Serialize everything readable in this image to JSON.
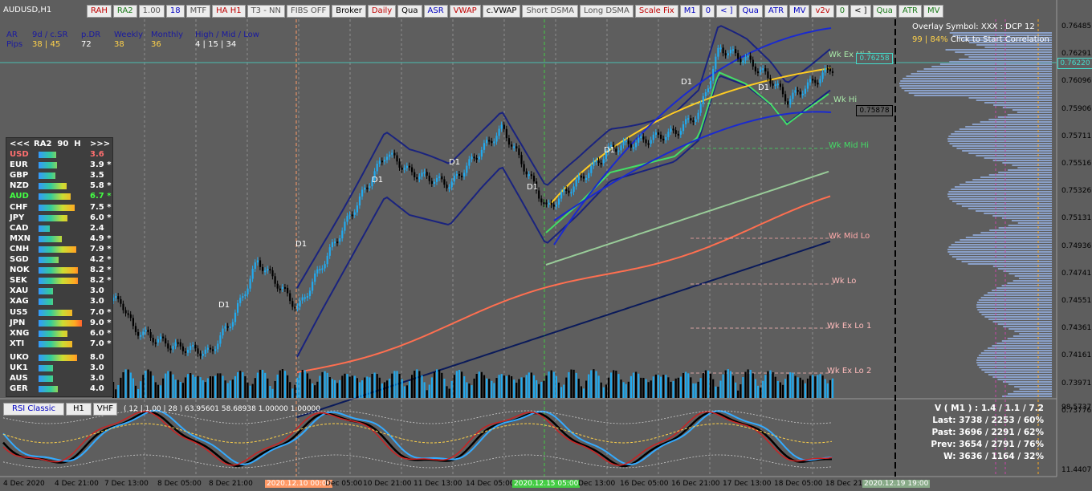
{
  "window": {
    "symbol": "AUDUSD,H1"
  },
  "toolbar": [
    {
      "label": "RAH",
      "color": "#c00000"
    },
    {
      "label": "RA2",
      "color": "#1a7a1a"
    },
    {
      "label": "1.00",
      "color": "#555555"
    },
    {
      "label": "18",
      "color": "#0000c0"
    },
    {
      "label": "MTF",
      "color": "#555555"
    },
    {
      "label": "HA H1",
      "color": "#c00000"
    },
    {
      "label": "T3 - NN",
      "color": "#555555"
    },
    {
      "label": "FIBS OFF",
      "color": "#555555"
    },
    {
      "label": "Broker",
      "color": "#000000"
    },
    {
      "label": "Daily",
      "color": "#c00000"
    },
    {
      "label": "Qua",
      "color": "#000000"
    },
    {
      "label": "ASR",
      "color": "#0000c0"
    },
    {
      "label": "VWAP",
      "color": "#c00000"
    },
    {
      "label": "c.VWAP",
      "color": "#000000"
    },
    {
      "label": "Short DSMA",
      "color": "#555555"
    },
    {
      "label": "Long DSMA",
      "color": "#555555"
    },
    {
      "label": "Scale Fix",
      "color": "#c00000"
    },
    {
      "label": "M1",
      "color": "#0000c0"
    },
    {
      "label": "0",
      "color": "#0000c0"
    },
    {
      "label": "< ]",
      "color": "#0000c0"
    },
    {
      "label": "Qua",
      "color": "#0000c0"
    },
    {
      "label": "ATR",
      "color": "#0000c0"
    },
    {
      "label": "MV",
      "color": "#0000c0"
    },
    {
      "label": "v2v",
      "color": "#c00000"
    },
    {
      "label": "0",
      "color": "#1a7a1a"
    },
    {
      "label": "< ]",
      "color": "#000000"
    },
    {
      "label": "Qua",
      "color": "#1a7a1a"
    },
    {
      "label": "ATR",
      "color": "#1a7a1a"
    },
    {
      "label": "MV",
      "color": "#1a7a1a"
    }
  ],
  "stats": {
    "headers": [
      "AR",
      "9d / c.SR",
      "p.DR",
      "Weekly",
      "Monthly",
      "High / Mid / Low"
    ],
    "row_label": "Pips",
    "values": [
      "38 | 45",
      "72",
      "38",
      "36",
      "4 | 15 | 34"
    ]
  },
  "overlay": {
    "line1": "Overlay Symbol: XXX : DCP 12",
    "line2_pct": "99 | 84%",
    "line2_text": "Click to Start Correlation"
  },
  "ra2_panel": {
    "header_left": "<<<",
    "title": "RA2  90  H",
    "header_right": ">>>",
    "rows": [
      {
        "cur": "USD",
        "val": "3.6",
        "color": "#ff6f6f",
        "bar": 0.36
      },
      {
        "cur": "EUR",
        "val": "3.9 *",
        "color": "#ffffff",
        "bar": 0.39
      },
      {
        "cur": "GBP",
        "val": "3.5",
        "color": "#ffffff",
        "bar": 0.35
      },
      {
        "cur": "NZD",
        "val": "5.8 *",
        "color": "#ffffff",
        "bar": 0.58
      },
      {
        "cur": "AUD",
        "val": "6.7 *",
        "color": "#44ff44",
        "bar": 0.67
      },
      {
        "cur": "CHF",
        "val": "7.5 *",
        "color": "#ffffff",
        "bar": 0.75
      },
      {
        "cur": "JPY",
        "val": "6.0 *",
        "color": "#ffffff",
        "bar": 0.6
      },
      {
        "cur": "CAD",
        "val": "2.4",
        "color": "#ffffff",
        "bar": 0.24
      },
      {
        "cur": "MXN",
        "val": "4.9 *",
        "color": "#ffffff",
        "bar": 0.49
      },
      {
        "cur": "CNH",
        "val": "7.9 *",
        "color": "#ffffff",
        "bar": 0.79
      },
      {
        "cur": "SGD",
        "val": "4.2 *",
        "color": "#ffffff",
        "bar": 0.42
      },
      {
        "cur": "NOK",
        "val": "8.2 *",
        "color": "#ffffff",
        "bar": 0.82
      },
      {
        "cur": "SEK",
        "val": "8.2 *",
        "color": "#ffffff",
        "bar": 0.82
      },
      {
        "cur": "XAU",
        "val": "3.0",
        "color": "#ffffff",
        "bar": 0.3
      },
      {
        "cur": "XAG",
        "val": "3.0",
        "color": "#ffffff",
        "bar": 0.3
      },
      {
        "cur": "US5",
        "val": "7.0 *",
        "color": "#ffffff",
        "bar": 0.7
      },
      {
        "cur": "JPN",
        "val": "9.0 *",
        "color": "#ffffff",
        "bar": 0.9
      },
      {
        "cur": "XNG",
        "val": "6.0 *",
        "color": "#ffffff",
        "bar": 0.6
      },
      {
        "cur": "XTI",
        "val": "7.0 *",
        "color": "#ffffff",
        "bar": 0.7
      },
      {
        "cur": "UKO",
        "val": "8.0",
        "color": "#ffffff",
        "bar": 0.8
      },
      {
        "cur": "UK1",
        "val": "3.0",
        "color": "#ffffff",
        "bar": 0.3
      },
      {
        "cur": "AUS",
        "val": "3.0",
        "color": "#ffffff",
        "bar": 0.3
      },
      {
        "cur": "GER",
        "val": "4.0",
        "color": "#ffffff",
        "bar": 0.4
      }
    ]
  },
  "levels": {
    "wk_ex_hi_1": "Wk Ex Hi 1",
    "wk_hi": "Wk Hi",
    "wk_mid_hi": "Wk Mid Hi",
    "wk_mid_lo": "Wk Mid Lo",
    "wk_lo": "Wk Lo",
    "wk_ex_lo_1": "Wk Ex Lo 1",
    "wk_ex_lo_2": "Wk Ex Lo 2",
    "d1": "D1"
  },
  "price_tags": {
    "top_tag": "0.76258",
    "mid_tag": "0.75878",
    "current": "0.76220"
  },
  "price_axis": [
    "0.76485",
    "0.76291",
    "0.76096",
    "0.75906",
    "0.75711",
    "0.75516",
    "0.75326",
    "0.75131",
    "0.74936",
    "0.74741",
    "0.74551",
    "0.74361",
    "0.74161",
    "0.73971",
    "0.73776"
  ],
  "osc_axis": {
    "top": "98.57377",
    "bottom": "11.44076"
  },
  "osc_toolbar": {
    "rsi": "RSI Classic",
    "tf": "H1",
    "vhf": "VHF",
    "params": "( 12 | 1.00 | 28 ) 63.95601 58.68938 1.00000 1.00000"
  },
  "vbox": [
    "V ( M1 ) : 1.4 / 1.1 / 7.2",
    "Last: 3738 / 2253 / 60%",
    "Past: 3696 / 2291 / 62%",
    "Prev: 3654 / 2791 / 76%",
    "W: 3636 / 1164 / 32%"
  ],
  "time_axis": [
    {
      "label": "4 Dec 2020",
      "hl": ""
    },
    {
      "label": "4 Dec 21:00",
      "hl": ""
    },
    {
      "label": "7 Dec 13:00",
      "hl": ""
    },
    {
      "label": "8 Dec 05:00",
      "hl": ""
    },
    {
      "label": "8 Dec 21:00",
      "hl": ""
    },
    {
      "label": "2020.12.10 00:00",
      "hl": "#ff9966"
    },
    {
      "label": "Dec 05:00",
      "hl": ""
    },
    {
      "label": "10 Dec 21:00",
      "hl": ""
    },
    {
      "label": "11 Dec 13:00",
      "hl": ""
    },
    {
      "label": "14 Dec 05:00",
      "hl": ""
    },
    {
      "label": "2020.12.15 05:00",
      "hl": "#44cc44"
    },
    {
      "label": "Dec 13:00",
      "hl": ""
    },
    {
      "label": "16 Dec 05:00",
      "hl": ""
    },
    {
      "label": "16 Dec 21:00",
      "hl": ""
    },
    {
      "label": "17 Dec 13:00",
      "hl": ""
    },
    {
      "label": "18 Dec 05:00",
      "hl": ""
    },
    {
      "label": "18 Dec 21:00",
      "hl": ""
    },
    {
      "label": "2020.12.19 19:00",
      "hl": "#88aa88"
    }
  ],
  "colors": {
    "bg": "#5e5e5e",
    "up": "#22aaee",
    "down": "#000000",
    "accent": "#ffd24a"
  }
}
